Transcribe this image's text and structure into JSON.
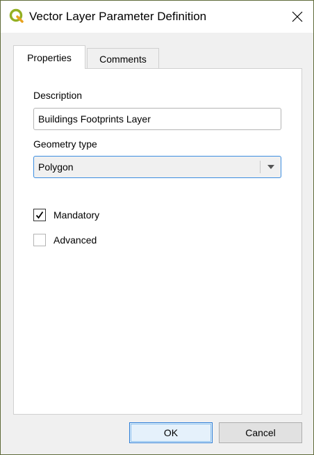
{
  "window": {
    "title": "Vector Layer Parameter Definition",
    "app_icon": "qgis-logo-icon",
    "close_icon": "close-icon"
  },
  "tabs": [
    {
      "label": "Properties",
      "selected": true
    },
    {
      "label": "Comments",
      "selected": false
    }
  ],
  "form": {
    "description_label": "Description",
    "description_value": "Buildings Footprints Layer",
    "geometry_label": "Geometry type",
    "geometry_value": "Polygon",
    "mandatory": {
      "label": "Mandatory",
      "checked": true
    },
    "advanced": {
      "label": "Advanced",
      "checked": false
    }
  },
  "buttons": {
    "ok_label": "OK",
    "cancel_label": "Cancel"
  },
  "colors": {
    "accent": "#3b8de0",
    "qgis_green": "#93b023"
  }
}
